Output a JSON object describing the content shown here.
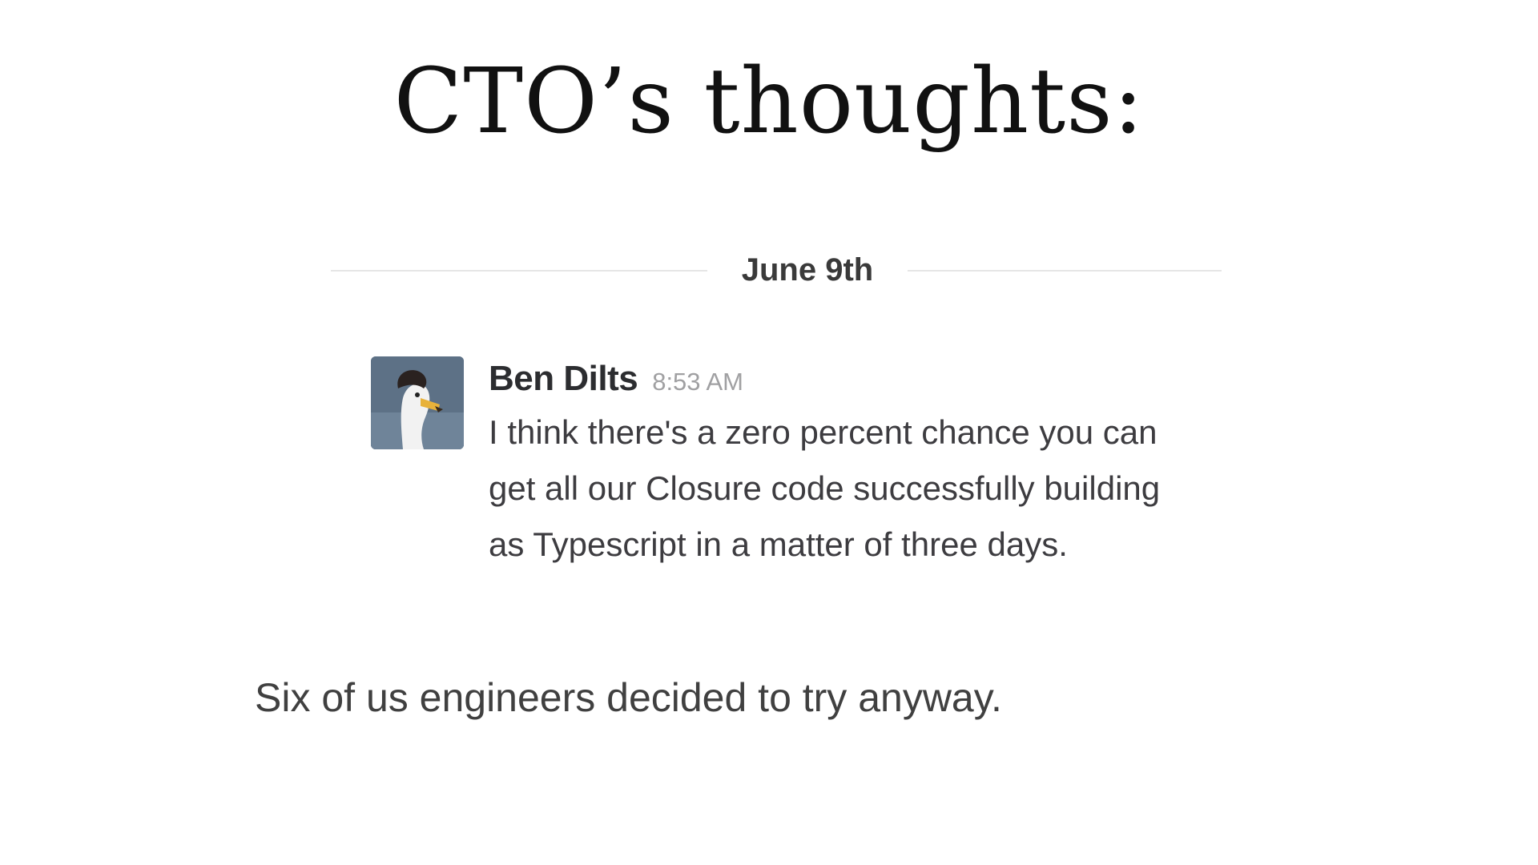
{
  "slide": {
    "title": "CTO’s thoughts:",
    "caption": "Six of us engineers decided to try anyway."
  },
  "chat": {
    "date_divider": "June 9th",
    "message": {
      "author": "Ben Dilts",
      "timestamp": "8:53 AM",
      "text": "I think there's a zero percent chance you can get all our Closure code successfully building as Typescript in a matter of three days.",
      "avatar_icon": "goose-avatar-icon"
    }
  },
  "colors": {
    "background": "#ffffff",
    "divider_line": "#e6e6e6",
    "author_text": "#2c2d30",
    "timestamp_text": "#a0a0a2",
    "message_text": "#3d3c40",
    "avatar_background": "#5d7186"
  }
}
